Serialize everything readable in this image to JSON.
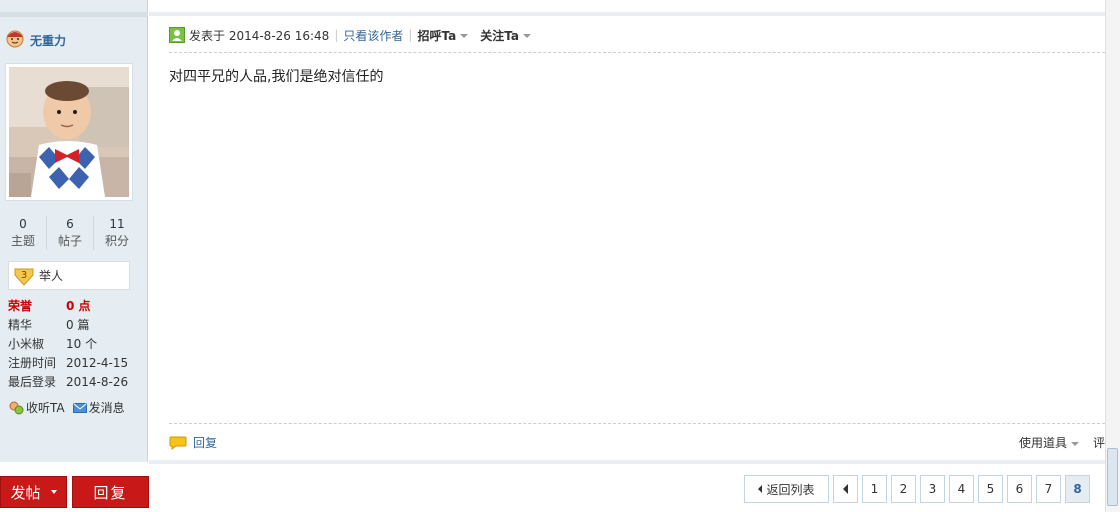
{
  "user": {
    "name": "无重力",
    "stats": [
      {
        "num": "0",
        "label": "主题"
      },
      {
        "num": "6",
        "label": "帖子"
      },
      {
        "num": "11",
        "label": "积分"
      }
    ],
    "rank": {
      "level": "3",
      "label": "举人"
    },
    "info": [
      {
        "key": "荣誉",
        "val": "0 点",
        "highlight": true
      },
      {
        "key": "精华",
        "val": "0 篇"
      },
      {
        "key": "小米椒",
        "val": "10 个"
      },
      {
        "key": "注册时间",
        "val": "2012-4-15"
      },
      {
        "key": "最后登录",
        "val": "2014-8-26"
      }
    ],
    "actions": {
      "follow": "收听TA",
      "message": "发消息"
    }
  },
  "post": {
    "posted_at": "发表于 2014-8-26 16:48",
    "only_author": "只看该作者",
    "greet": "招呼Ta",
    "follow": "关注Ta",
    "content": "对四平兄的人品,我们是绝对信任的",
    "reply": "回复",
    "tools": "使用道具",
    "tools_extra": "评"
  },
  "bottom": {
    "post_button": "发帖",
    "reply_button": "回复",
    "back_to_list": "返回列表",
    "pages": [
      "1",
      "2",
      "3",
      "4",
      "5",
      "6",
      "7",
      "8"
    ],
    "current_page": "8"
  },
  "colors": {
    "accent": "#336699",
    "button_red": "#c91818",
    "sidebar_bg": "#e5edf2"
  }
}
